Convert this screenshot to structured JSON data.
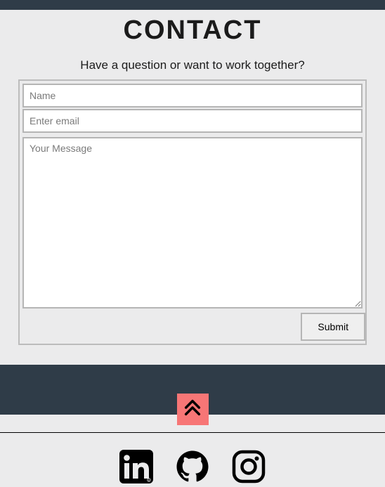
{
  "contact": {
    "heading": "CONTACT",
    "subheading": "Have a question or want to work together?",
    "name_placeholder": "Name",
    "email_placeholder": "Enter email",
    "message_placeholder": "Your Message",
    "submit_label": "Submit"
  },
  "footer": {
    "scroll_top_label": "Scroll to top",
    "social": {
      "linkedin": "LinkedIn",
      "github": "GitHub",
      "instagram": "Instagram"
    }
  },
  "colors": {
    "page_bg": "#ebebec",
    "header_bg": "#2f3c48",
    "accent": "#f77676",
    "text": "#1b1b1b",
    "border": "#b5b5b5"
  }
}
